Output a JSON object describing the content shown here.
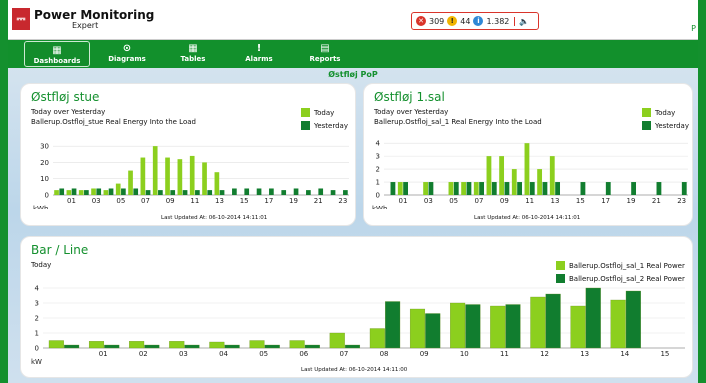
{
  "header": {
    "app_title": "Power Monitoring",
    "app_subtitle": "Expert",
    "alarms": {
      "critical": "309",
      "warning": "44",
      "info": "1.382"
    },
    "edge_letter": "P"
  },
  "nav": [
    {
      "label": "Dashboards",
      "icon": "dashboard-icon"
    },
    {
      "label": "Diagrams",
      "icon": "diagram-icon"
    },
    {
      "label": "Tables",
      "icon": "table-icon"
    },
    {
      "label": "Alarms",
      "icon": "alarm-icon"
    },
    {
      "label": "Reports",
      "icon": "report-icon"
    }
  ],
  "section_title": "Østfløj PoP",
  "cards": {
    "stue": {
      "title": "Østfløj stue",
      "sub1": "Today over Yesterday",
      "sub2": "Ballerup.Ostfloj_stue Real Energy Into the Load",
      "legend": [
        "Today",
        "Yesterday"
      ],
      "unit": "kWh",
      "updated": "Last Updated At: 06-10-2014 14:11:01"
    },
    "sal1": {
      "title": "Østfløj 1.sal",
      "sub1": "Today over Yesterday",
      "sub2": "Ballerup.Ostfloj_sal_1 Real Energy Into the Load",
      "legend": [
        "Today",
        "Yesterday"
      ],
      "unit": "kWh",
      "updated": "Last Updated At: 06-10-2014 14:11:01"
    },
    "barline": {
      "title": "Bar / Line",
      "sub1": "Today",
      "legend": [
        "Ballerup.Ostfloj_sal_1 Real Power",
        "Ballerup.Ostfloj_sal_2 Real Power"
      ],
      "unit": "kW",
      "updated": "Last Updated At: 06-10-2014 14:11:00"
    }
  },
  "chart_data": [
    {
      "type": "bar",
      "x_ticks": [
        "01",
        "03",
        "05",
        "07",
        "09",
        "11",
        "13",
        "15",
        "17",
        "19",
        "21",
        "23"
      ],
      "y_ticks": [
        "0",
        "10",
        "20",
        "30"
      ],
      "ylim": [
        0,
        35
      ],
      "categories": [
        "00",
        "01",
        "02",
        "03",
        "04",
        "05",
        "06",
        "07",
        "08",
        "09",
        "10",
        "11",
        "12",
        "13",
        "14",
        "15",
        "16",
        "17",
        "18",
        "19",
        "20",
        "21",
        "22",
        "23"
      ],
      "series": [
        {
          "name": "Today",
          "values": [
            3,
            3,
            3,
            4,
            3,
            7,
            15,
            23,
            30,
            23,
            22,
            24,
            20,
            14,
            0,
            0,
            0,
            0,
            0,
            0,
            0,
            0,
            0,
            0
          ]
        },
        {
          "name": "Yesterday",
          "values": [
            4,
            4,
            3,
            4,
            4,
            4,
            4,
            3,
            3,
            3,
            3,
            3,
            3,
            3,
            4,
            4,
            4,
            4,
            3,
            4,
            3,
            4,
            3,
            3
          ]
        }
      ],
      "xlabel": "kWh"
    },
    {
      "type": "bar",
      "x_ticks": [
        "01",
        "03",
        "05",
        "07",
        "09",
        "11",
        "13",
        "15",
        "17",
        "19",
        "21",
        "23"
      ],
      "y_ticks": [
        "0",
        "1",
        "2",
        "3",
        "4"
      ],
      "ylim": [
        0,
        4.4
      ],
      "categories": [
        "00",
        "01",
        "02",
        "03",
        "04",
        "05",
        "06",
        "07",
        "08",
        "09",
        "10",
        "11",
        "12",
        "13",
        "14",
        "15",
        "16",
        "17",
        "18",
        "19",
        "20",
        "21",
        "22",
        "23"
      ],
      "series": [
        {
          "name": "Today",
          "values": [
            0,
            1,
            0,
            1,
            0,
            1,
            1,
            1,
            3,
            3,
            2,
            4,
            2,
            3,
            0,
            0,
            0,
            0,
            0,
            0,
            0,
            0,
            0,
            0
          ]
        },
        {
          "name": "Yesterday",
          "values": [
            1,
            1,
            0,
            1,
            0,
            1,
            1,
            1,
            1,
            1,
            1,
            1,
            1,
            1,
            0,
            1,
            0,
            1,
            0,
            1,
            0,
            1,
            0,
            1
          ]
        }
      ],
      "xlabel": "kWh"
    },
    {
      "type": "bar",
      "x_ticks": [
        "01",
        "02",
        "03",
        "04",
        "05",
        "06",
        "07",
        "08",
        "09",
        "10",
        "11",
        "12",
        "13",
        "14",
        "15"
      ],
      "y_ticks": [
        "0",
        "1",
        "2",
        "3",
        "4"
      ],
      "ylim": [
        0,
        4.2
      ],
      "categories": [
        "00",
        "01",
        "02",
        "03",
        "04",
        "05",
        "06",
        "07",
        "08",
        "09",
        "10",
        "11",
        "12",
        "13",
        "14",
        "15"
      ],
      "series": [
        {
          "name": "Ballerup.Ostfloj_sal_1 Real Power",
          "values": [
            0.5,
            0.45,
            0.45,
            0.45,
            0.4,
            0.5,
            0.5,
            1.0,
            1.3,
            2.6,
            3.0,
            2.8,
            3.4,
            2.8,
            3.2,
            0
          ]
        },
        {
          "name": "Ballerup.Ostfloj_sal_2 Real Power",
          "values": [
            0.2,
            0.2,
            0.2,
            0.2,
            0.2,
            0.2,
            0.2,
            0.2,
            3.1,
            2.3,
            2.9,
            2.9,
            3.6,
            4.0,
            3.8,
            0
          ]
        }
      ],
      "xlabel": "kW"
    }
  ]
}
